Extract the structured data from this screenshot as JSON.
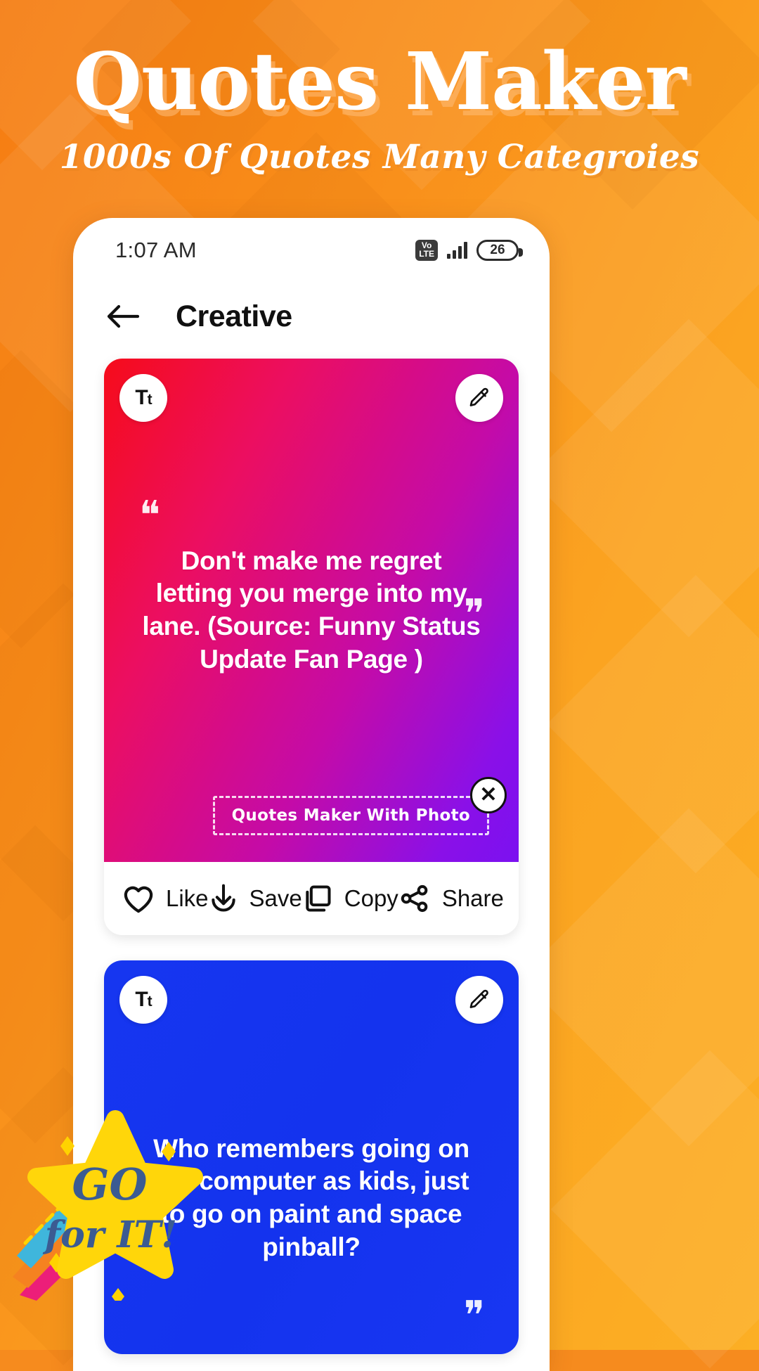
{
  "promo": {
    "title": "Quotes Maker",
    "subtitle": "1000s Of Quotes Many Categroies",
    "sticker_line1": "GO",
    "sticker_line2": "for IT!",
    "bg_color": "#F68B1E"
  },
  "status_bar": {
    "time": "1:07 AM",
    "volte_top": "Vo",
    "volte_bottom": "LTE",
    "signal_icon": "signal-bars-icon",
    "battery_level": "26"
  },
  "app_bar": {
    "back_icon": "back-arrow-icon",
    "title": "Creative"
  },
  "cards": [
    {
      "font_button": "Tt",
      "edit_icon": "pencil-edit-icon",
      "quote": "Don't make me regret letting you merge into my lane. (Source: Funny Status Update Fan Page )",
      "open_quote": "❝",
      "close_quote": "❞",
      "gradient_from": "#F60C1A",
      "gradient_to": "#7B11F0",
      "watermark": {
        "text": "Quotes Maker With Photo",
        "close_icon": "close-x-icon",
        "close_label": "✕"
      },
      "actions": [
        {
          "icon": "heart-icon",
          "label": "Like"
        },
        {
          "icon": "download-icon",
          "label": "Save"
        },
        {
          "icon": "copy-icon",
          "label": "Copy"
        },
        {
          "icon": "share-icon",
          "label": "Share"
        }
      ]
    },
    {
      "font_button": "Tt",
      "edit_icon": "pencil-edit-icon",
      "quote": "Who remembers going on the computer as kids, just to go on paint and space pinball?",
      "close_quote": "❞",
      "gradient_from": "#1636F0",
      "gradient_to": "#1836F2"
    }
  ]
}
